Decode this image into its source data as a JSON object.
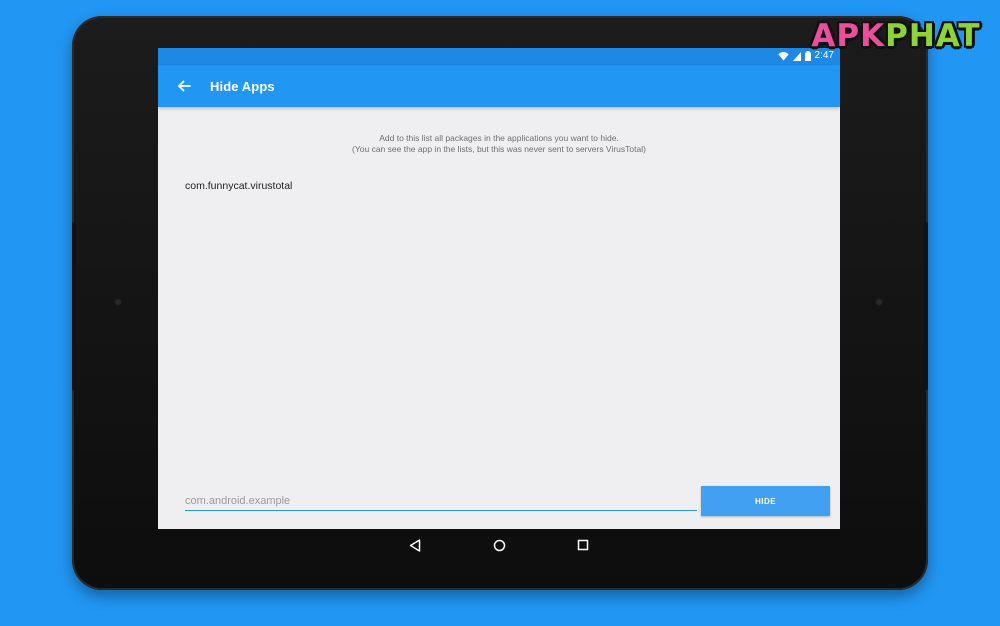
{
  "status_bar": {
    "time": "2:47"
  },
  "app_bar": {
    "title": "Hide Apps",
    "back_icon": "arrow-left-icon"
  },
  "content": {
    "hint_line1": "Add to this list all packages in the applications you want to hide.",
    "hint_line2": "(You can see the app in the lists, but this was never sent to servers VirusTotal)",
    "packages": [
      "com.funnycat.virustotal"
    ]
  },
  "input": {
    "placeholder": "com.android.example",
    "value": ""
  },
  "hide_button": {
    "label": "HIDE"
  },
  "watermark": {
    "part1": "APK",
    "part2": "PHAT"
  },
  "colors": {
    "background": "#2196f3",
    "app_bar": "#2196f3",
    "status_bar": "#1e88e5",
    "button": "#42a0f2",
    "screen": "#efeff1"
  }
}
